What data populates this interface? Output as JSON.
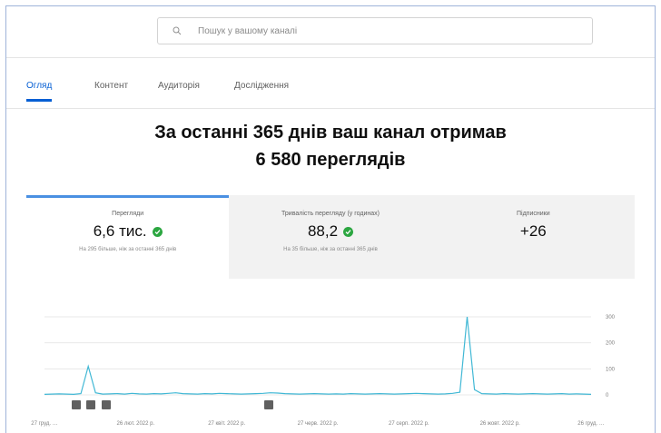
{
  "search": {
    "placeholder": "Пошук у вашому каналі"
  },
  "tabs": [
    {
      "label": "Огляд",
      "active": true
    },
    {
      "label": "Контент",
      "active": false
    },
    {
      "label": "Аудиторія",
      "active": false
    },
    {
      "label": "Дослідження",
      "active": false
    }
  ],
  "headline": {
    "line1": "За останні 365 днів ваш канал отримав",
    "line2": "6 580 переглядів"
  },
  "cards": [
    {
      "label": "Перегляди",
      "value": "6,6 тис.",
      "note": "На 295 більше, ніж за останні 365 днів",
      "status_icon": "check-icon"
    },
    {
      "label": "Тривалість перегляду (у годинах)",
      "value": "88,2",
      "note": "На 35 більше, ніж за останні 365 днів",
      "status_icon": "check-icon"
    },
    {
      "label": "Підписники",
      "value": "+26",
      "note": ""
    }
  ],
  "colors": {
    "accent": "#065fd4",
    "line": "#41b8d5",
    "ok": "#2ba640",
    "selected_card": "#4a90e2"
  },
  "chart_data": {
    "type": "line",
    "y_ticks": [
      "300",
      "200",
      "100",
      "0"
    ],
    "ylim": [
      0,
      300
    ],
    "x_ticks": [
      "27 груд. …",
      "26 лют. 2022 р.",
      "27 квіт. 2022 р.",
      "27 черв. 2022 р.",
      "27 серп. 2022 р.",
      "26 жовт. 2022 р.",
      "26 груд. …"
    ],
    "values": [
      2,
      3,
      4,
      3,
      2,
      5,
      110,
      8,
      3,
      4,
      5,
      3,
      6,
      4,
      3,
      5,
      4,
      6,
      8,
      5,
      4,
      3,
      5,
      4,
      6,
      5,
      4,
      3,
      4,
      5,
      6,
      8,
      7,
      5,
      4,
      3,
      4,
      5,
      4,
      3,
      4,
      3,
      5,
      4,
      3,
      4,
      5,
      4,
      3,
      4,
      5,
      6,
      5,
      4,
      3,
      4,
      6,
      10,
      300,
      20,
      5,
      4,
      3,
      5,
      4,
      3,
      4,
      5,
      4,
      3,
      4,
      5,
      3,
      4,
      3,
      2
    ],
    "markers": [
      "a",
      "a",
      "a",
      "b"
    ]
  }
}
